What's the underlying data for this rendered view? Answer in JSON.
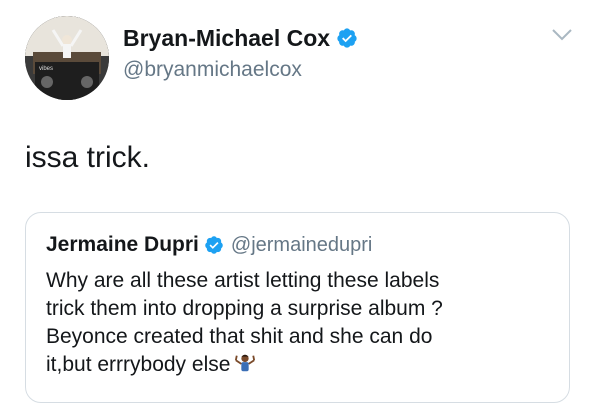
{
  "tweet": {
    "author_name": "Bryan-Michael Cox",
    "author_handle": "@bryanmichaelcox",
    "verified_icon": "verified-badge-icon",
    "menu_icon": "chevron-down-icon",
    "text": "issa trick."
  },
  "quoted_tweet": {
    "author_name": "Jermaine Dupri",
    "author_handle": "@jermainedupri",
    "verified_icon": "verified-badge-icon",
    "text": "Why are all these artist letting these labels\ntrick them into dropping a surprise album ?\nBeyonce created that shit and she can do\nit,but errrybody else",
    "emoji_icon": "person-shrugging-icon"
  },
  "colors": {
    "text": "#14171a",
    "secondary_text": "#657786",
    "verified_blue": "#1da1f2",
    "card_border": "#d6dde3"
  }
}
